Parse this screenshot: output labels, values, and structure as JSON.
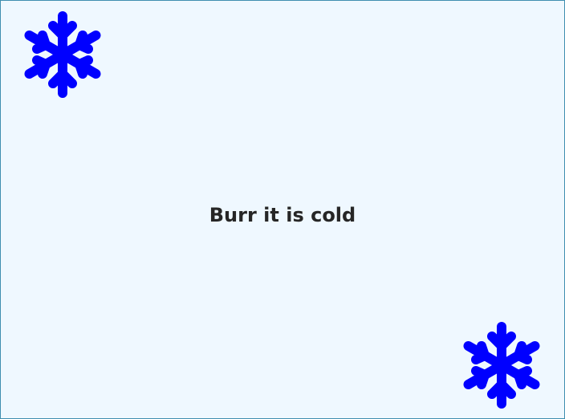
{
  "card": {
    "message": "Burr it is cold"
  },
  "icons": {
    "top_left": "snowflake-icon",
    "bottom_right": "snowflake-icon"
  },
  "colors": {
    "background": "#eff8ff",
    "border": "#3f8fb0",
    "snowflake": "#0000ff",
    "text": "#262626"
  }
}
